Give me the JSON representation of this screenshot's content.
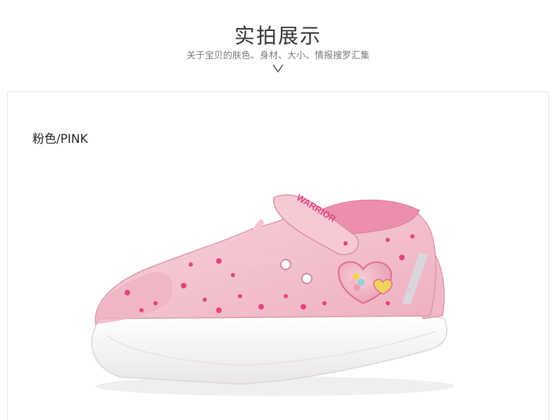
{
  "header": {
    "title": "实拍展示",
    "subtitle": "关于宝贝的肤色、身材、大小、情报搜罗汇集",
    "chevron_icon": "chevron-down-icon"
  },
  "product": {
    "color_label": "粉色/PINK",
    "strap_text": "WARRIOR",
    "image_icon": "pink-sneaker-photo",
    "colors": {
      "upper": "#f4c2cf",
      "upper_dark": "#e9a2b5",
      "print": "#e2457e",
      "sole": "#fbfbfb",
      "sole_edge": "#e7e3e3",
      "lining": "#ec8faf"
    }
  }
}
